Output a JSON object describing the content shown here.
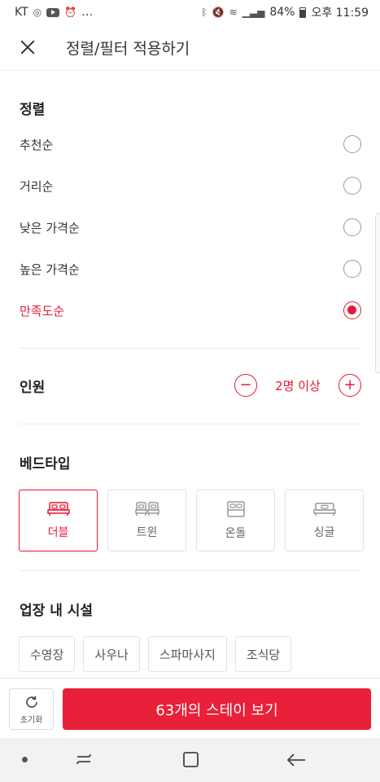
{
  "status_bar": {
    "carrier": "KT",
    "more": "…",
    "battery": "84%",
    "time": "오후 11:59"
  },
  "header": {
    "title": "정렬/필터 적용하기"
  },
  "sort": {
    "title": "정렬",
    "options": [
      {
        "label": "추천순",
        "selected": false
      },
      {
        "label": "거리순",
        "selected": false
      },
      {
        "label": "낮은 가격순",
        "selected": false
      },
      {
        "label": "높은 가격순",
        "selected": false
      },
      {
        "label": "만족도순",
        "selected": true
      }
    ]
  },
  "people": {
    "title": "인원",
    "value": "2명 이상",
    "minus": "−",
    "plus": "+"
  },
  "bed_type": {
    "title": "베드타입",
    "options": [
      {
        "label": "더블",
        "icon": "double-bed-icon",
        "selected": true
      },
      {
        "label": "트윈",
        "icon": "twin-bed-icon",
        "selected": false
      },
      {
        "label": "온돌",
        "icon": "ondol-icon",
        "selected": false
      },
      {
        "label": "싱글",
        "icon": "single-bed-icon",
        "selected": false
      }
    ]
  },
  "facilities": {
    "title": "업장 내 시설",
    "chips": [
      "수영장",
      "사우나",
      "스파마사지",
      "조식당"
    ]
  },
  "bottom": {
    "reset_label": "초기화",
    "apply_label": "63개의 스테이 보기"
  },
  "colors": {
    "accent": "#e51937",
    "button": "#e8203a"
  }
}
